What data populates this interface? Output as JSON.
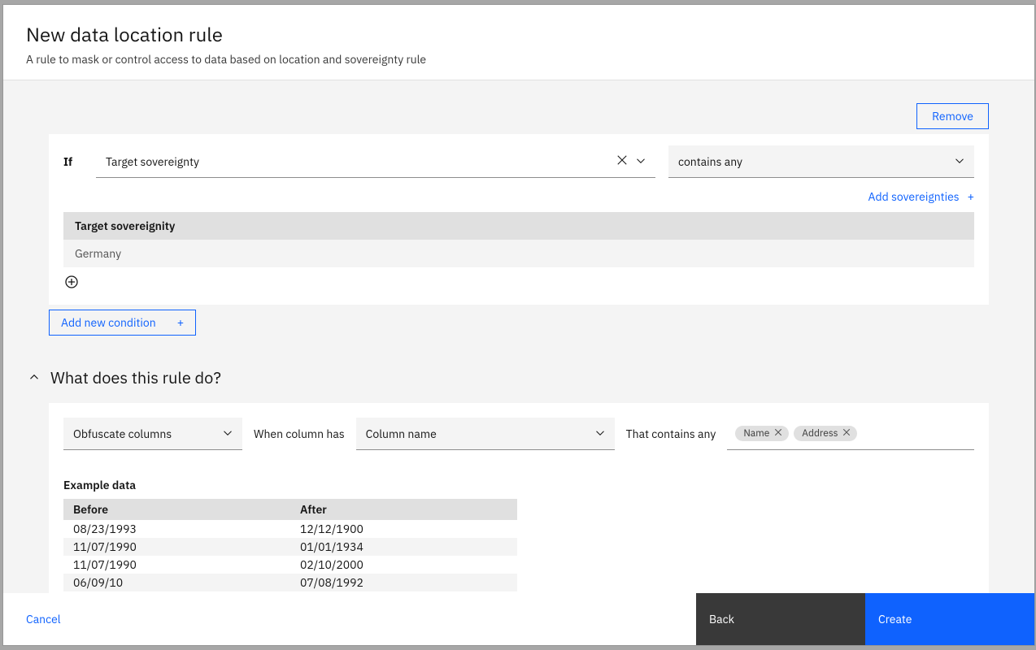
{
  "header": {
    "title": "New data location rule",
    "subtitle": "A rule to mask or control access to data based on location and sovereignty rule"
  },
  "condition": {
    "remove_label": "Remove",
    "if_label": "If",
    "target_value": "Target sovereignty",
    "operator_value": "contains any",
    "add_sovereignties_label": "Add sovereignties",
    "table_header": "Target sovereignity",
    "table_value": "Germany",
    "add_condition_label": "Add new condition"
  },
  "section": {
    "title": "What does this rule do?"
  },
  "action": {
    "action_select": "Obfuscate columns",
    "when_label": "When column has",
    "column_select": "Column name",
    "contains_label": "That contains any",
    "tags": [
      "Name",
      "Address"
    ]
  },
  "example": {
    "title": "Example data",
    "columns": [
      "Before",
      "After"
    ],
    "rows": [
      {
        "before": "08/23/1993",
        "after": "12/12/1900"
      },
      {
        "before": "11/07/1990",
        "after": "01/01/1934"
      },
      {
        "before": "11/07/1990",
        "after": "02/10/2000"
      },
      {
        "before": "06/09/10",
        "after": "07/08/1992"
      }
    ]
  },
  "footer": {
    "cancel": "Cancel",
    "back": "Back",
    "create": "Create"
  }
}
